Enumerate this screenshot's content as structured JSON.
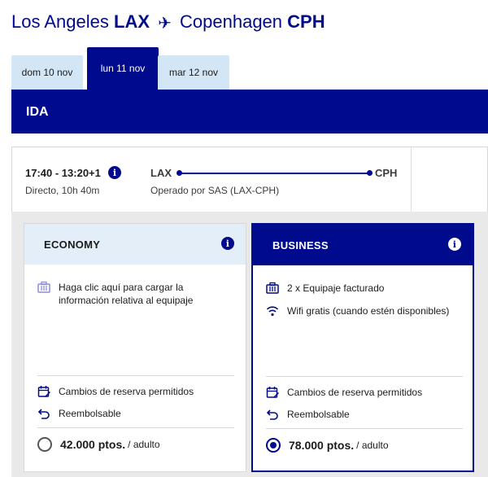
{
  "route": {
    "origin_city": "Los Angeles",
    "origin_code": "LAX",
    "destination_city": "Copenhagen",
    "destination_code": "CPH",
    "plane_icon": "plane-icon"
  },
  "date_tabs": [
    {
      "label": "dom 10 nov",
      "active": false
    },
    {
      "label": "lun 11 nov",
      "active": true
    },
    {
      "label": "mar 12 nov",
      "active": false
    }
  ],
  "direction_label": "IDA",
  "flight": {
    "times": "17:40 - 13:20+1",
    "duration": "Directo, 10h 40m",
    "from": "LAX",
    "to": "CPH",
    "operated_by": "Operado por SAS (LAX-CPH)"
  },
  "fares": {
    "economy": {
      "name": "ECONOMY",
      "baggage": "Haga clic aquí para cargar la información relativa al equipaje",
      "changes": "Cambios de reserva permitidos",
      "refund": "Reembolsable",
      "price": "42.000 ptos.",
      "unit": "/ adulto",
      "selected": false
    },
    "business": {
      "name": "BUSINESS",
      "baggage": "2 x Equipaje facturado",
      "wifi": "Wifi gratis (cuando estén disponibles)",
      "changes": "Cambios de reserva permitidos",
      "refund": "Reembolsable",
      "price": "78.000 ptos.",
      "unit": "/ adulto",
      "selected": true
    }
  },
  "colors": {
    "brand": "#000a8c",
    "tab_inactive": "#d3e6f5",
    "economy_header": "#e3eef8",
    "fare_background": "#e9e9e9"
  }
}
